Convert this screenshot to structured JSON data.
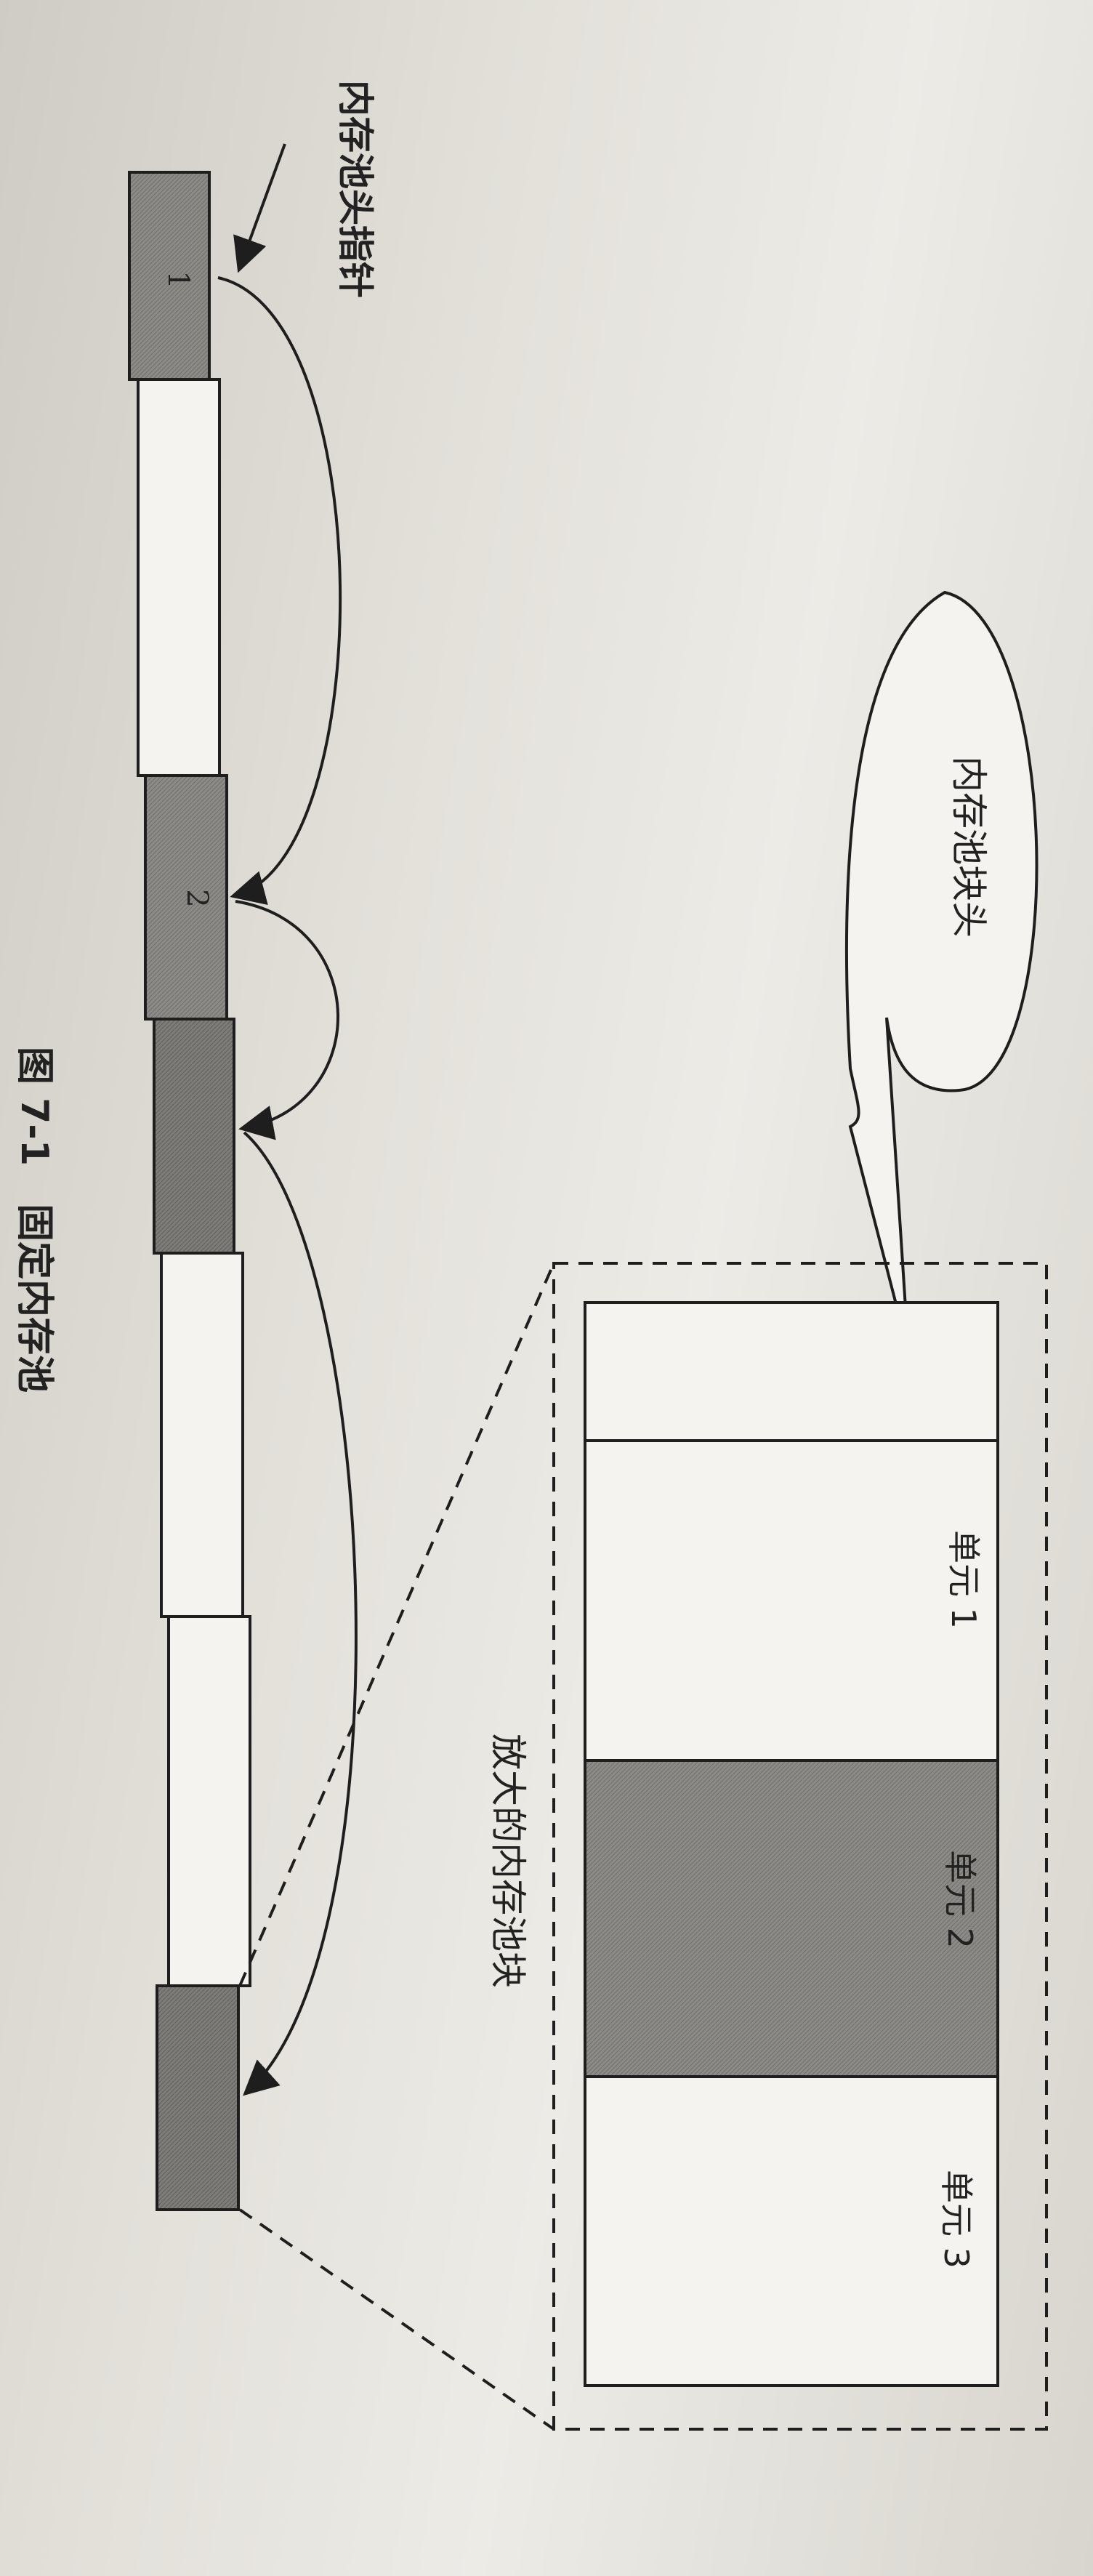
{
  "diagram": {
    "pool_head_pointer_label": "内存池头指针",
    "block_header_bubble_label": "内存池块头",
    "enlarged_block_label": "放大的内存池块",
    "caption": "图 7-1　固定内存池",
    "block_numbers": [
      "1",
      "2"
    ],
    "unit_labels": [
      "单元 1",
      "单元 2",
      "单元 3"
    ],
    "colors": {
      "used": "#8a8884",
      "free": "#f4f3ef",
      "line": "#1e1e1e"
    }
  }
}
